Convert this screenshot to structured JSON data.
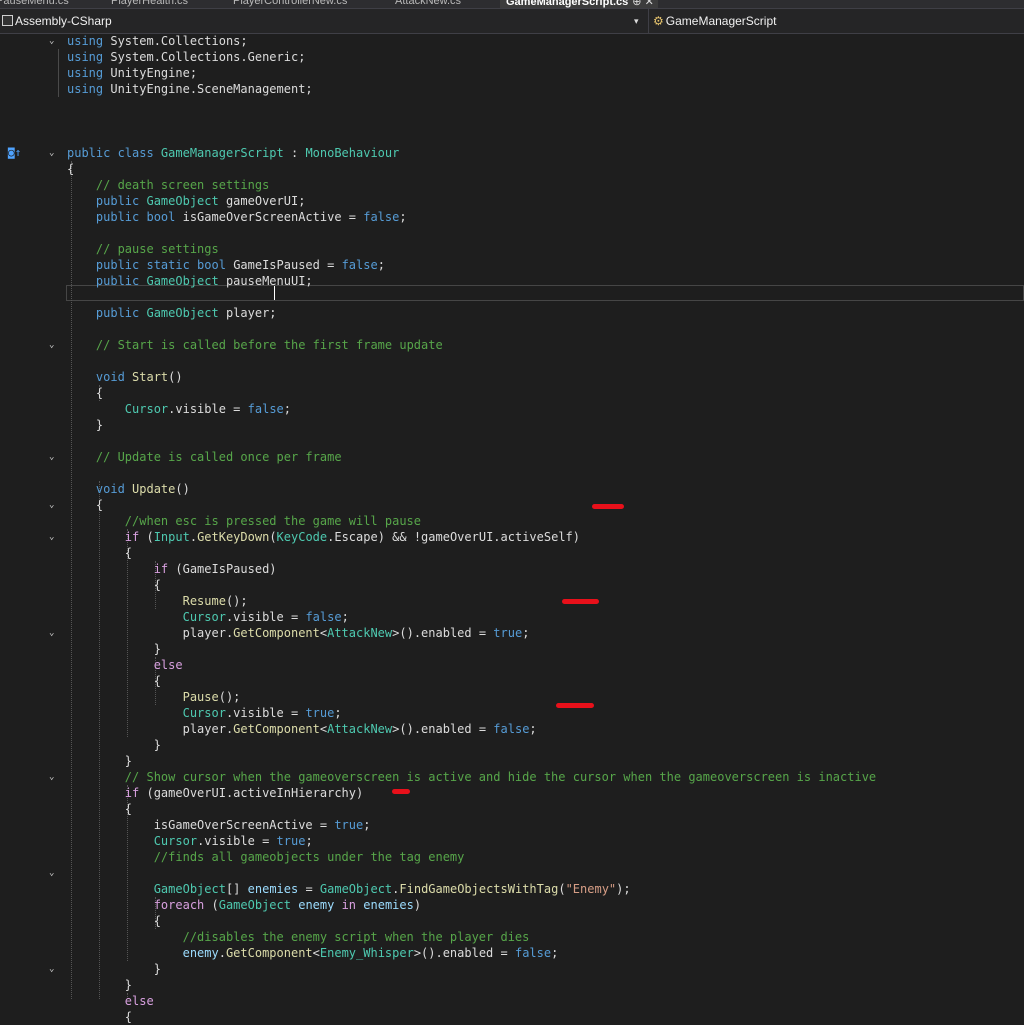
{
  "tabs": [
    {
      "label": "PauseMenu.cs",
      "active": false
    },
    {
      "label": "PlayerHealth.cs",
      "active": false
    },
    {
      "label": "PlayerControllerNew.cs",
      "active": false
    },
    {
      "label": "AttackNew.cs",
      "active": false
    },
    {
      "label": "GameManagerScript.cs",
      "active": true
    }
  ],
  "tab_icons": {
    "pin": "⊕",
    "close": "✕"
  },
  "nav": {
    "project": "Assembly-CSharp",
    "dropdown_glyph": "▾",
    "class": "GameManagerScript",
    "class_icon": "⚙"
  },
  "colors": {
    "keyword": "#569cd6",
    "control": "#d8a0df",
    "type": "#4ec9b0",
    "comment": "#57a64a",
    "method": "#dcdcaa",
    "string": "#d69d85",
    "plain": "#dcdcdc",
    "annotation": "#e8101a"
  },
  "gutter_markers": [
    {
      "line": 7,
      "text": "◙↑"
    }
  ],
  "fold_lines": [
    0,
    7,
    19,
    26,
    29,
    31,
    37,
    46,
    52,
    58
  ],
  "lines": [
    [
      [
        "kw",
        "using "
      ],
      [
        "pl",
        "System.Collections;"
      ]
    ],
    [
      [
        "kw",
        "using "
      ],
      [
        "pl",
        "System.Collections.Generic;"
      ]
    ],
    [
      [
        "kw",
        "using "
      ],
      [
        "pl",
        "UnityEngine;"
      ]
    ],
    [
      [
        "kw",
        "using "
      ],
      [
        "pl",
        "UnityEngine.SceneManagement;"
      ]
    ],
    [],
    [],
    [],
    [
      [
        "kw",
        "public class "
      ],
      [
        "ty",
        "GameManagerScript"
      ],
      [
        "pl",
        " : "
      ],
      [
        "ty",
        "MonoBehaviour"
      ]
    ],
    [
      [
        "pl",
        "{"
      ]
    ],
    [
      [
        "pl",
        "    "
      ],
      [
        "cm",
        "// death screen settings"
      ]
    ],
    [
      [
        "pl",
        "    "
      ],
      [
        "kw",
        "public "
      ],
      [
        "ty",
        "GameObject"
      ],
      [
        "pl",
        " gameOverUI;"
      ]
    ],
    [
      [
        "pl",
        "    "
      ],
      [
        "kw",
        "public bool "
      ],
      [
        "pl",
        "isGameOverScreenActive = "
      ],
      [
        "kw",
        "false"
      ],
      [
        "pl",
        ";"
      ]
    ],
    [],
    [
      [
        "pl",
        "    "
      ],
      [
        "cm",
        "// pause settings"
      ]
    ],
    [
      [
        "pl",
        "    "
      ],
      [
        "kw",
        "public static bool "
      ],
      [
        "pl",
        "GameIsPaused = "
      ],
      [
        "kw",
        "false"
      ],
      [
        "pl",
        ";"
      ]
    ],
    [
      [
        "pl",
        "    "
      ],
      [
        "kw",
        "public "
      ],
      [
        "ty",
        "GameObject"
      ],
      [
        "pl",
        " pauseMenuUI;"
      ]
    ],
    [],
    [
      [
        "pl",
        "    "
      ],
      [
        "kw",
        "public "
      ],
      [
        "ty",
        "GameObject"
      ],
      [
        "pl",
        " player;"
      ]
    ],
    [],
    [
      [
        "pl",
        "    "
      ],
      [
        "cm",
        "// Start is called before the first frame update"
      ]
    ],
    [],
    [
      [
        "pl",
        "    "
      ],
      [
        "kw",
        "void "
      ],
      [
        "fn",
        "Start"
      ],
      [
        "pl",
        "()"
      ]
    ],
    [
      [
        "pl",
        "    {"
      ]
    ],
    [
      [
        "pl",
        "        "
      ],
      [
        "ty",
        "Cursor"
      ],
      [
        "pl",
        ".visible = "
      ],
      [
        "kw",
        "false"
      ],
      [
        "pl",
        ";"
      ]
    ],
    [
      [
        "pl",
        "    }"
      ]
    ],
    [],
    [
      [
        "pl",
        "    "
      ],
      [
        "cm",
        "// Update is called once per frame"
      ]
    ],
    [],
    [
      [
        "pl",
        "    "
      ],
      [
        "kw",
        "void "
      ],
      [
        "fn",
        "Update"
      ],
      [
        "pl",
        "()"
      ]
    ],
    [
      [
        "pl",
        "    {"
      ]
    ],
    [
      [
        "pl",
        "        "
      ],
      [
        "cm",
        "//when esc is pressed the game will pause"
      ]
    ],
    [
      [
        "pl",
        "        "
      ],
      [
        "ctl",
        "if"
      ],
      [
        "pl",
        " ("
      ],
      [
        "ty",
        "Input"
      ],
      [
        "pl",
        "."
      ],
      [
        "fn",
        "GetKeyDown"
      ],
      [
        "pl",
        "("
      ],
      [
        "ty",
        "KeyCode"
      ],
      [
        "pl",
        ".Escape) && !gameOverUI.activeSelf)"
      ]
    ],
    [
      [
        "pl",
        "        {"
      ]
    ],
    [
      [
        "pl",
        "            "
      ],
      [
        "ctl",
        "if"
      ],
      [
        "pl",
        " (GameIsPaused)"
      ]
    ],
    [
      [
        "pl",
        "            {"
      ]
    ],
    [
      [
        "pl",
        "                "
      ],
      [
        "fn",
        "Resume"
      ],
      [
        "pl",
        "();"
      ]
    ],
    [
      [
        "pl",
        "                "
      ],
      [
        "ty",
        "Cursor"
      ],
      [
        "pl",
        ".visible = "
      ],
      [
        "kw",
        "false"
      ],
      [
        "pl",
        ";"
      ]
    ],
    [
      [
        "pl",
        "                player."
      ],
      [
        "fn",
        "GetComponent"
      ],
      [
        "pl",
        "<"
      ],
      [
        "ty",
        "AttackNew"
      ],
      [
        "pl",
        ">().enabled = "
      ],
      [
        "kw",
        "true"
      ],
      [
        "pl",
        ";"
      ]
    ],
    [
      [
        "pl",
        "            }"
      ]
    ],
    [
      [
        "pl",
        "            "
      ],
      [
        "ctl",
        "else"
      ]
    ],
    [
      [
        "pl",
        "            {"
      ]
    ],
    [
      [
        "pl",
        "                "
      ],
      [
        "fn",
        "Pause"
      ],
      [
        "pl",
        "();"
      ]
    ],
    [
      [
        "pl",
        "                "
      ],
      [
        "ty",
        "Cursor"
      ],
      [
        "pl",
        ".visible = "
      ],
      [
        "kw",
        "true"
      ],
      [
        "pl",
        ";"
      ]
    ],
    [
      [
        "pl",
        "                player."
      ],
      [
        "fn",
        "GetComponent"
      ],
      [
        "pl",
        "<"
      ],
      [
        "ty",
        "AttackNew"
      ],
      [
        "pl",
        ">().enabled = "
      ],
      [
        "kw",
        "false"
      ],
      [
        "pl",
        ";"
      ]
    ],
    [
      [
        "pl",
        "            }"
      ]
    ],
    [
      [
        "pl",
        "        }"
      ]
    ],
    [
      [
        "pl",
        "        "
      ],
      [
        "cm",
        "// Show cursor when the gameoverscreen is active and hide the cursor when the gameoverscreen is inactive"
      ]
    ],
    [
      [
        "pl",
        "        "
      ],
      [
        "ctl",
        "if"
      ],
      [
        "pl",
        " (gameOverUI.activeInHierarchy)"
      ]
    ],
    [
      [
        "pl",
        "        {"
      ]
    ],
    [
      [
        "pl",
        "            isGameOverScreenActive = "
      ],
      [
        "kw",
        "true"
      ],
      [
        "pl",
        ";"
      ]
    ],
    [
      [
        "pl",
        "            "
      ],
      [
        "ty",
        "Cursor"
      ],
      [
        "pl",
        ".visible = "
      ],
      [
        "kw",
        "true"
      ],
      [
        "pl",
        ";"
      ]
    ],
    [
      [
        "pl",
        "            "
      ],
      [
        "cm",
        "//finds all gameobjects under the tag enemy"
      ]
    ],
    [],
    [
      [
        "pl",
        "            "
      ],
      [
        "ty",
        "GameObject"
      ],
      [
        "pl",
        "[] "
      ],
      [
        "var",
        "enemies"
      ],
      [
        "pl",
        " = "
      ],
      [
        "ty",
        "GameObject"
      ],
      [
        "pl",
        "."
      ],
      [
        "fn",
        "FindGameObjectsWithTag"
      ],
      [
        "pl",
        "("
      ],
      [
        "str",
        "\"Enemy\""
      ],
      [
        "pl",
        ");"
      ]
    ],
    [
      [
        "pl",
        "            "
      ],
      [
        "ctl",
        "foreach"
      ],
      [
        "pl",
        " ("
      ],
      [
        "ty",
        "GameObject"
      ],
      [
        "pl",
        " "
      ],
      [
        "var",
        "enemy"
      ],
      [
        "pl",
        " "
      ],
      [
        "ctl",
        "in"
      ],
      [
        "pl",
        " "
      ],
      [
        "var",
        "enemies"
      ],
      [
        "pl",
        ")"
      ]
    ],
    [
      [
        "pl",
        "            {"
      ]
    ],
    [
      [
        "pl",
        "                "
      ],
      [
        "cm",
        "//disables the enemy script when the player dies"
      ]
    ],
    [
      [
        "pl",
        "                "
      ],
      [
        "var",
        "enemy"
      ],
      [
        "pl",
        "."
      ],
      [
        "fn",
        "GetComponent"
      ],
      [
        "pl",
        "<"
      ],
      [
        "ty",
        "Enemy_Whisper"
      ],
      [
        "pl",
        ">().enabled = "
      ],
      [
        "kw",
        "false"
      ],
      [
        "pl",
        ";"
      ]
    ],
    [
      [
        "pl",
        "            }"
      ]
    ],
    [
      [
        "pl",
        "        }"
      ]
    ],
    [
      [
        "pl",
        "        "
      ],
      [
        "ctl",
        "else"
      ]
    ],
    [
      [
        "pl",
        "        {"
      ]
    ]
  ]
}
